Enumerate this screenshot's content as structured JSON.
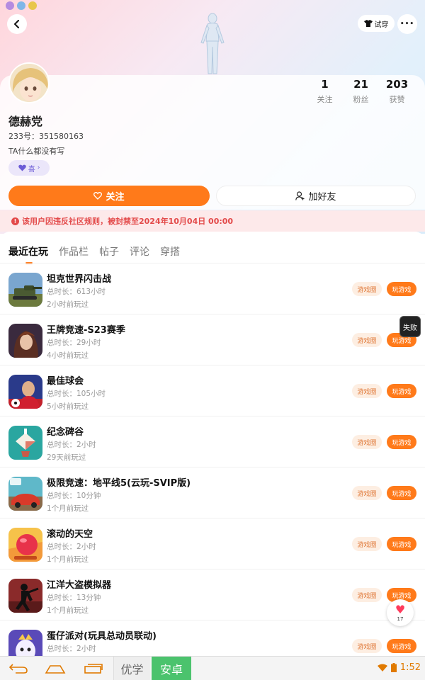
{
  "header": {
    "tryon_label": "试穿",
    "more_label": "•••"
  },
  "profile": {
    "username": "德赫党",
    "uid_text": "233号：351580163",
    "bio": "TA什么都没有写",
    "badge_label": "喜",
    "stats": [
      {
        "value": "1",
        "label": "关注"
      },
      {
        "value": "21",
        "label": "粉丝"
      },
      {
        "value": "203",
        "label": "获赞"
      }
    ]
  },
  "actions": {
    "follow_label": "关注",
    "add_friend_label": "加好友"
  },
  "ban_notice": "该用户因违反社区规则，被封禁至2024年10月04日 00:00",
  "tabs": [
    {
      "label": "最近在玩",
      "active": true
    },
    {
      "label": "作品栏",
      "active": false
    },
    {
      "label": "帖子",
      "active": false
    },
    {
      "label": "评论",
      "active": false
    },
    {
      "label": "穿搭",
      "active": false
    }
  ],
  "games": [
    {
      "name": "坦克世界闪击战",
      "duration": "总时长：613小时",
      "last_played": "2小时前玩过",
      "circle_label": "游戏圈",
      "play_label": "玩游戏",
      "icon": "tank-game-icon"
    },
    {
      "name": "王牌竞速-S23赛季",
      "duration": "总时长：29小时",
      "last_played": "4小时前玩过",
      "circle_label": "游戏圈",
      "play_label": "玩游戏",
      "icon": "racing-game-icon"
    },
    {
      "name": "最佳球会",
      "duration": "总时长：105小时",
      "last_played": "5小时前玩过",
      "circle_label": "游戏圈",
      "play_label": "玩游戏",
      "icon": "soccer-game-icon"
    },
    {
      "name": "纪念碑谷",
      "duration": "总时长：2小时",
      "last_played": "29天前玩过",
      "circle_label": "游戏圈",
      "play_label": "玩游戏",
      "icon": "monument-game-icon"
    },
    {
      "name": "极限竞速：地平线5(云玩-SVIP版)",
      "duration": "总时长：10分钟",
      "last_played": "1个月前玩过",
      "circle_label": "游戏圈",
      "play_label": "玩游戏",
      "icon": "forza-game-icon"
    },
    {
      "name": "滚动的天空",
      "duration": "总时长：2小时",
      "last_played": "1个月前玩过",
      "circle_label": "游戏圈",
      "play_label": "玩游戏",
      "icon": "rolling-sky-game-icon"
    },
    {
      "name": "江洋大盗模拟器",
      "duration": "总时长：13分钟",
      "last_played": "1个月前玩过",
      "circle_label": "游戏圈",
      "play_label": "玩游戏",
      "icon": "thief-game-icon"
    },
    {
      "name": "蛋仔派对(玩具总动员联动)",
      "duration": "总时长：2小时",
      "last_played": "",
      "circle_label": "游戏圈",
      "play_label": "玩游戏",
      "icon": "eggy-party-game-icon"
    }
  ],
  "float_widget_label": "失败",
  "like_count": "17",
  "nav": {
    "ime_1": "优学",
    "ime_2": "安卓",
    "time": "1:52"
  },
  "colors": {
    "accent": "#ff7a1a",
    "ban_text": "#e34a4a",
    "ban_bg": "#fde9ea"
  }
}
